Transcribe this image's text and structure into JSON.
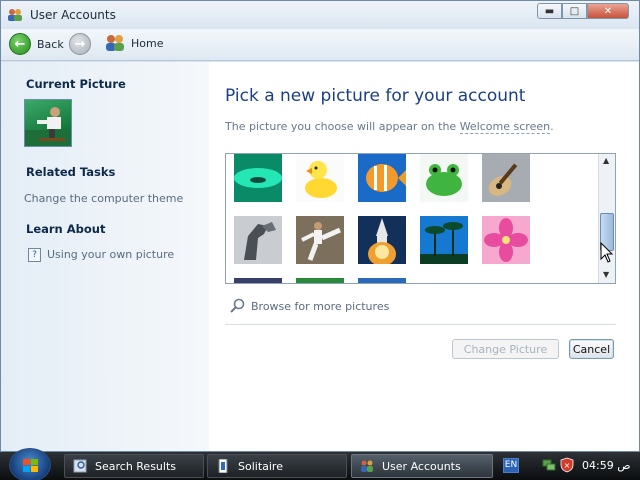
{
  "window": {
    "title": "User Accounts"
  },
  "navbar": {
    "back_label": "Back",
    "home_label": "Home"
  },
  "left_panel": {
    "current_picture_heading": "Current Picture",
    "related_tasks_heading": "Related Tasks",
    "related_tasks_link": "Change the computer theme",
    "learn_about_heading": "Learn About",
    "learn_about_link": "Using your own picture"
  },
  "main": {
    "title": "Pick a new picture for your account",
    "subtitle_prefix": "The picture you choose will appear on the ",
    "subtitle_link": "Welcome screen",
    "subtitle_suffix": ".",
    "pictures": [
      {
        "name": "green-water-drop",
        "colors": [
          "#0fd9a6",
          "#05624a"
        ]
      },
      {
        "name": "rubber-duck",
        "colors": [
          "#ffe44a",
          "#fafafa"
        ]
      },
      {
        "name": "tropical-fish",
        "colors": [
          "#f29a2c",
          "#1f6bc4"
        ]
      },
      {
        "name": "frog",
        "colors": [
          "#3fb53f",
          "#e8f0e8"
        ]
      },
      {
        "name": "guitar",
        "colors": [
          "#d7b782",
          "#9aa0a6"
        ]
      },
      {
        "name": "horse",
        "colors": [
          "#5a5f66",
          "#c9ccd0"
        ]
      },
      {
        "name": "karate",
        "colors": [
          "#8a7e6a",
          "#d8d2c6"
        ]
      },
      {
        "name": "space-shuttle",
        "colors": [
          "#f0a030",
          "#12305a"
        ]
      },
      {
        "name": "palm-trees",
        "colors": [
          "#1679d1",
          "#0b3d25"
        ]
      },
      {
        "name": "pink-flower",
        "colors": [
          "#e84c9e",
          "#ff9ccf"
        ]
      }
    ],
    "browse_label": "Browse for more pictures",
    "change_button": "Change Picture",
    "cancel_button": "Cancel"
  },
  "taskbar": {
    "items": [
      {
        "label": "Search Results"
      },
      {
        "label": "Solitaire"
      },
      {
        "label": "User Accounts",
        "active": true
      }
    ],
    "language": "EN",
    "clock": "04:59 ص"
  }
}
